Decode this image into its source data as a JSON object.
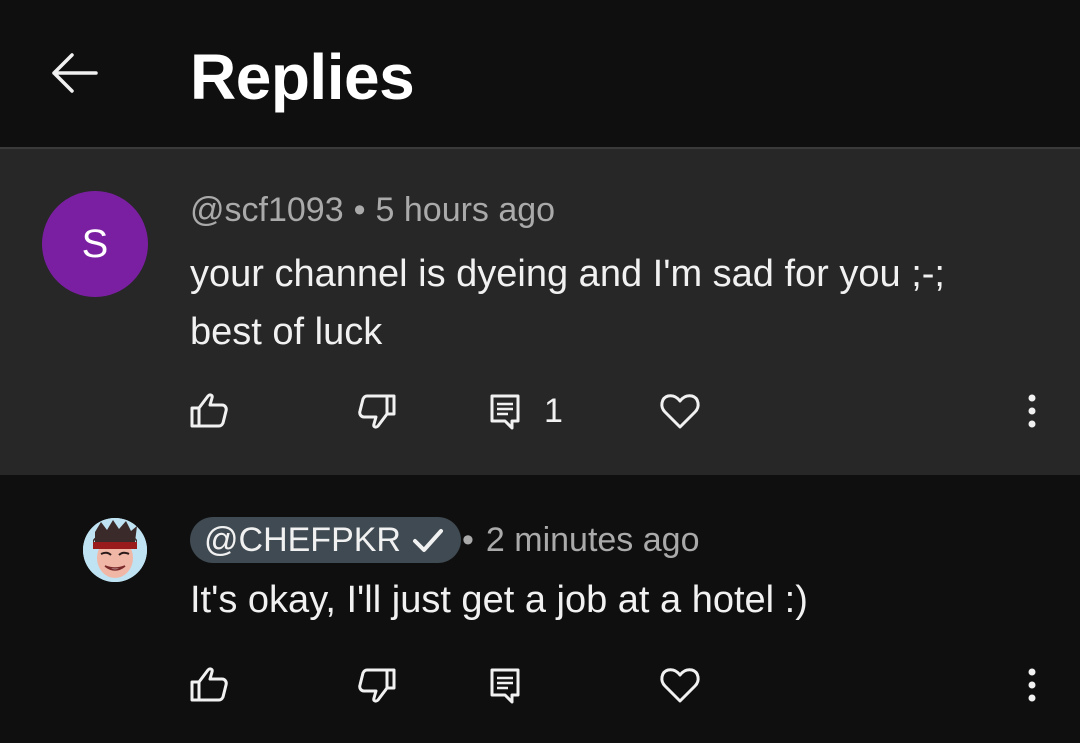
{
  "header": {
    "title": "Replies",
    "back_icon": "arrow-left-icon"
  },
  "comment": {
    "avatar_letter": "S",
    "avatar_color": "#7b1fa2",
    "author": "@scf1093",
    "separator": "•",
    "time": "5 hours ago",
    "text_line1": "your channel is dyeing and I'm sad for you ;-;",
    "text_line2": "best of luck",
    "reply_count": "1",
    "icons": [
      "thumbs-up-icon",
      "thumbs-down-icon",
      "reply-icon",
      "heart-icon",
      "more-vert-icon"
    ]
  },
  "reply": {
    "author": "@CHEFPKR",
    "verified_icon": "checkmark-icon",
    "separator": "•",
    "time": "2 minutes ago",
    "text": "It's okay, I'll just get a job at a hotel :)",
    "icons": [
      "thumbs-up-icon",
      "thumbs-down-icon",
      "reply-icon",
      "heart-icon",
      "more-vert-icon"
    ]
  },
  "colors": {
    "background": "#0f0f0f",
    "highlighted_comment_bg": "#272727",
    "channel_chip_bg": "#3f4a52",
    "secondary_text": "#aaaaaa"
  }
}
